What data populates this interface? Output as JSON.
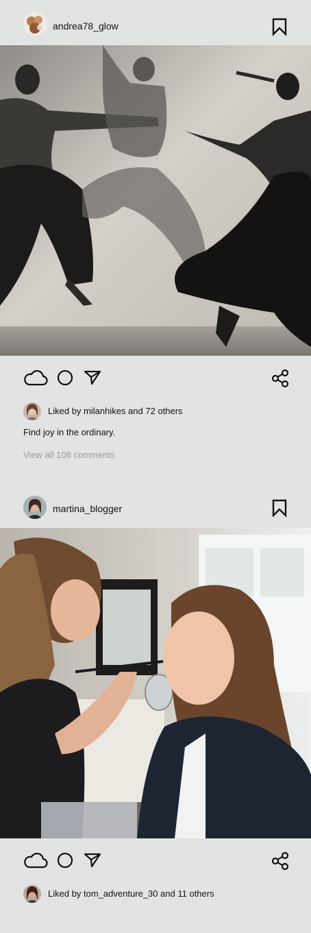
{
  "posts": [
    {
      "username": "andrea78_glow",
      "likes_text": "Liked by milanhikes and 72 others",
      "caption": "Find joy in the ordinary.",
      "comments_link": "View all 108 comments",
      "image_alt": "Three dancers leaping in motion, black and white photo"
    },
    {
      "username": "martina_blogger",
      "likes_text": "Liked by tom_adventure_30 and 11 others",
      "image_alt": "Makeup artist applying eyeshadow to a smiling woman"
    }
  ],
  "icons": {
    "like": "cloud-icon",
    "comment": "circle-icon",
    "send": "paper-plane-icon",
    "share": "share-icon",
    "bookmark": "bookmark-icon"
  },
  "colors": {
    "background": "#e2e4e4",
    "muted_text": "#9a9d9d",
    "text": "#111111"
  }
}
